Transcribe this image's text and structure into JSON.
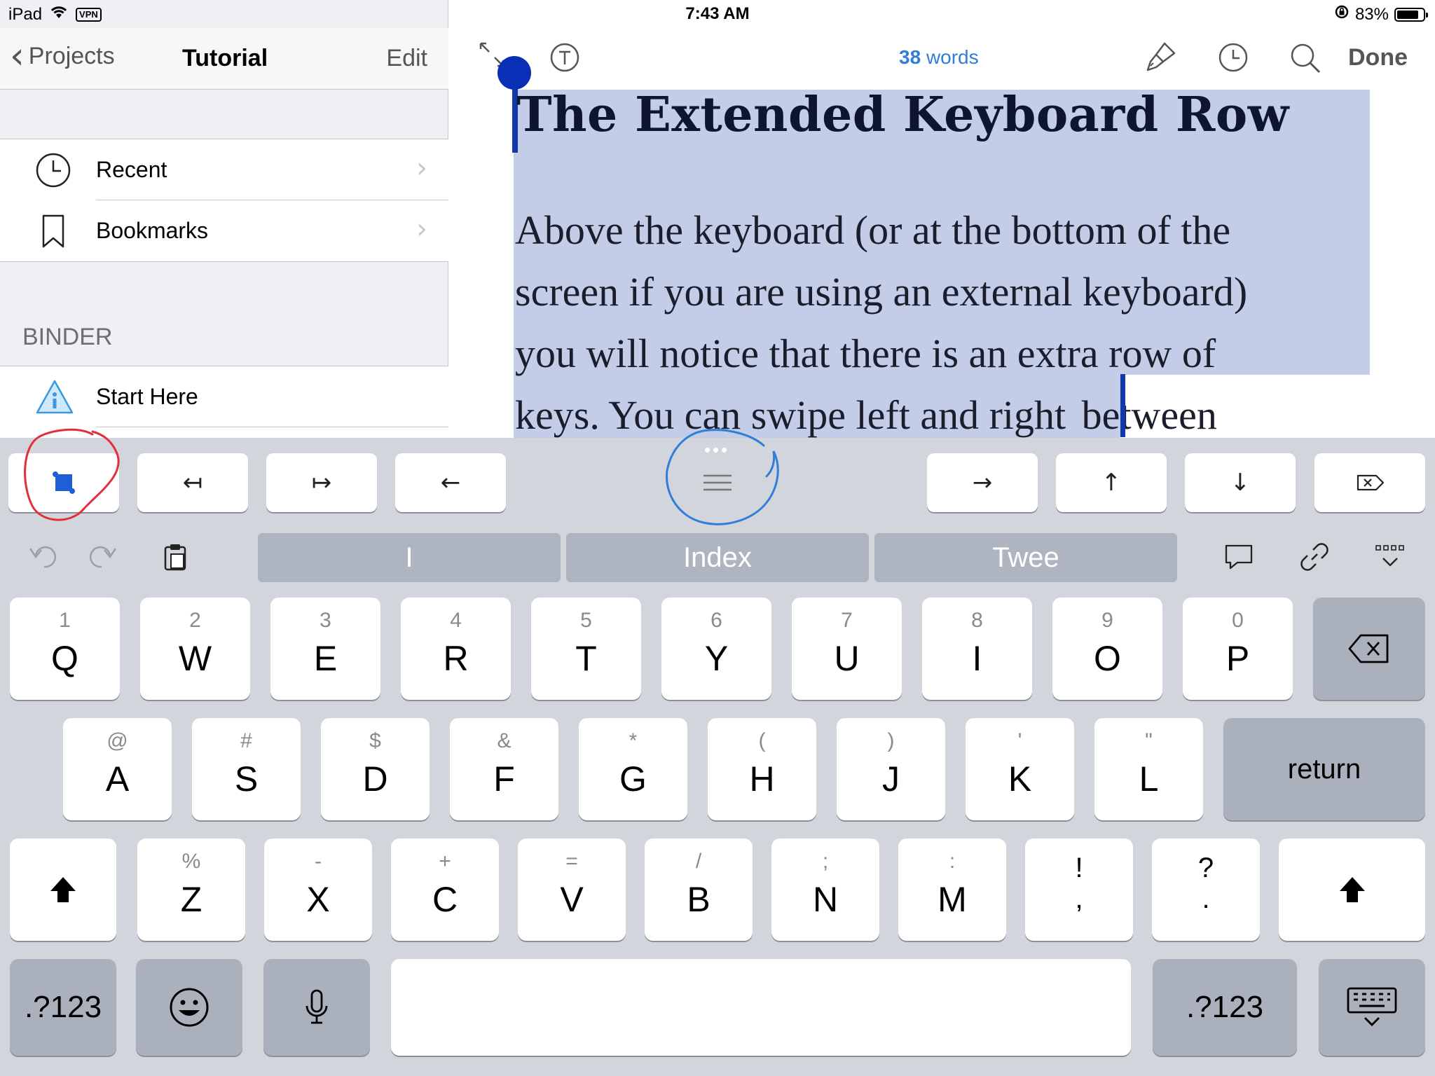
{
  "status_bar": {
    "device": "iPad",
    "vpn": "VPN",
    "time": "7:43 AM",
    "battery": "83%",
    "battery_level": 0.83
  },
  "sidebar": {
    "back_label": "Projects",
    "title": "Tutorial",
    "edit_label": "Edit",
    "items": [
      {
        "label": "Recent",
        "icon": "clock-icon"
      },
      {
        "label": "Bookmarks",
        "icon": "bookmark-icon"
      }
    ],
    "binder_header": "BINDER",
    "binder_items": [
      {
        "label": "Start Here",
        "icon": "info-triangle-icon"
      }
    ]
  },
  "editor": {
    "word_count_number": "38",
    "word_count_label": "words",
    "done_label": "Done",
    "heading": "The Extended Keyboard Row",
    "body_lines": [
      "Above the keyboard (or at the bottom of the",
      "screen if you are using an external keyboard)",
      "you will notice that there is an extra row of",
      "keys. You can swipe left and right"
    ],
    "after_caret": "between",
    "colors": {
      "selection": "#c4cde8",
      "accent": "#2f7fd6",
      "handle": "#0a2fb6"
    }
  },
  "keyboard": {
    "suggestions": [
      "I",
      "Index",
      "Twee"
    ],
    "row1": [
      {
        "hint": "1",
        "label": "Q"
      },
      {
        "hint": "2",
        "label": "W"
      },
      {
        "hint": "3",
        "label": "E"
      },
      {
        "hint": "4",
        "label": "R"
      },
      {
        "hint": "5",
        "label": "T"
      },
      {
        "hint": "6",
        "label": "Y"
      },
      {
        "hint": "7",
        "label": "U"
      },
      {
        "hint": "8",
        "label": "I"
      },
      {
        "hint": "9",
        "label": "O"
      },
      {
        "hint": "0",
        "label": "P"
      }
    ],
    "row2": [
      {
        "hint": "@",
        "label": "A"
      },
      {
        "hint": "#",
        "label": "S"
      },
      {
        "hint": "$",
        "label": "D"
      },
      {
        "hint": "&",
        "label": "F"
      },
      {
        "hint": "*",
        "label": "G"
      },
      {
        "hint": "(",
        "label": "H"
      },
      {
        "hint": ")",
        "label": "J"
      },
      {
        "hint": "'",
        "label": "K"
      },
      {
        "hint": "\"",
        "label": "L"
      }
    ],
    "return_label": "return",
    "row3": [
      {
        "hint": "%",
        "label": "Z"
      },
      {
        "hint": "-",
        "label": "X"
      },
      {
        "hint": "+",
        "label": "C"
      },
      {
        "hint": "=",
        "label": "V"
      },
      {
        "hint": "/",
        "label": "B"
      },
      {
        "hint": ";",
        "label": "N"
      },
      {
        "hint": ":",
        "label": "M"
      }
    ],
    "punct": [
      {
        "top": "!",
        "bottom": ","
      },
      {
        "top": "?",
        "bottom": "."
      }
    ],
    "numbers_label": ".?123",
    "numbers_label_right": ".?123"
  }
}
